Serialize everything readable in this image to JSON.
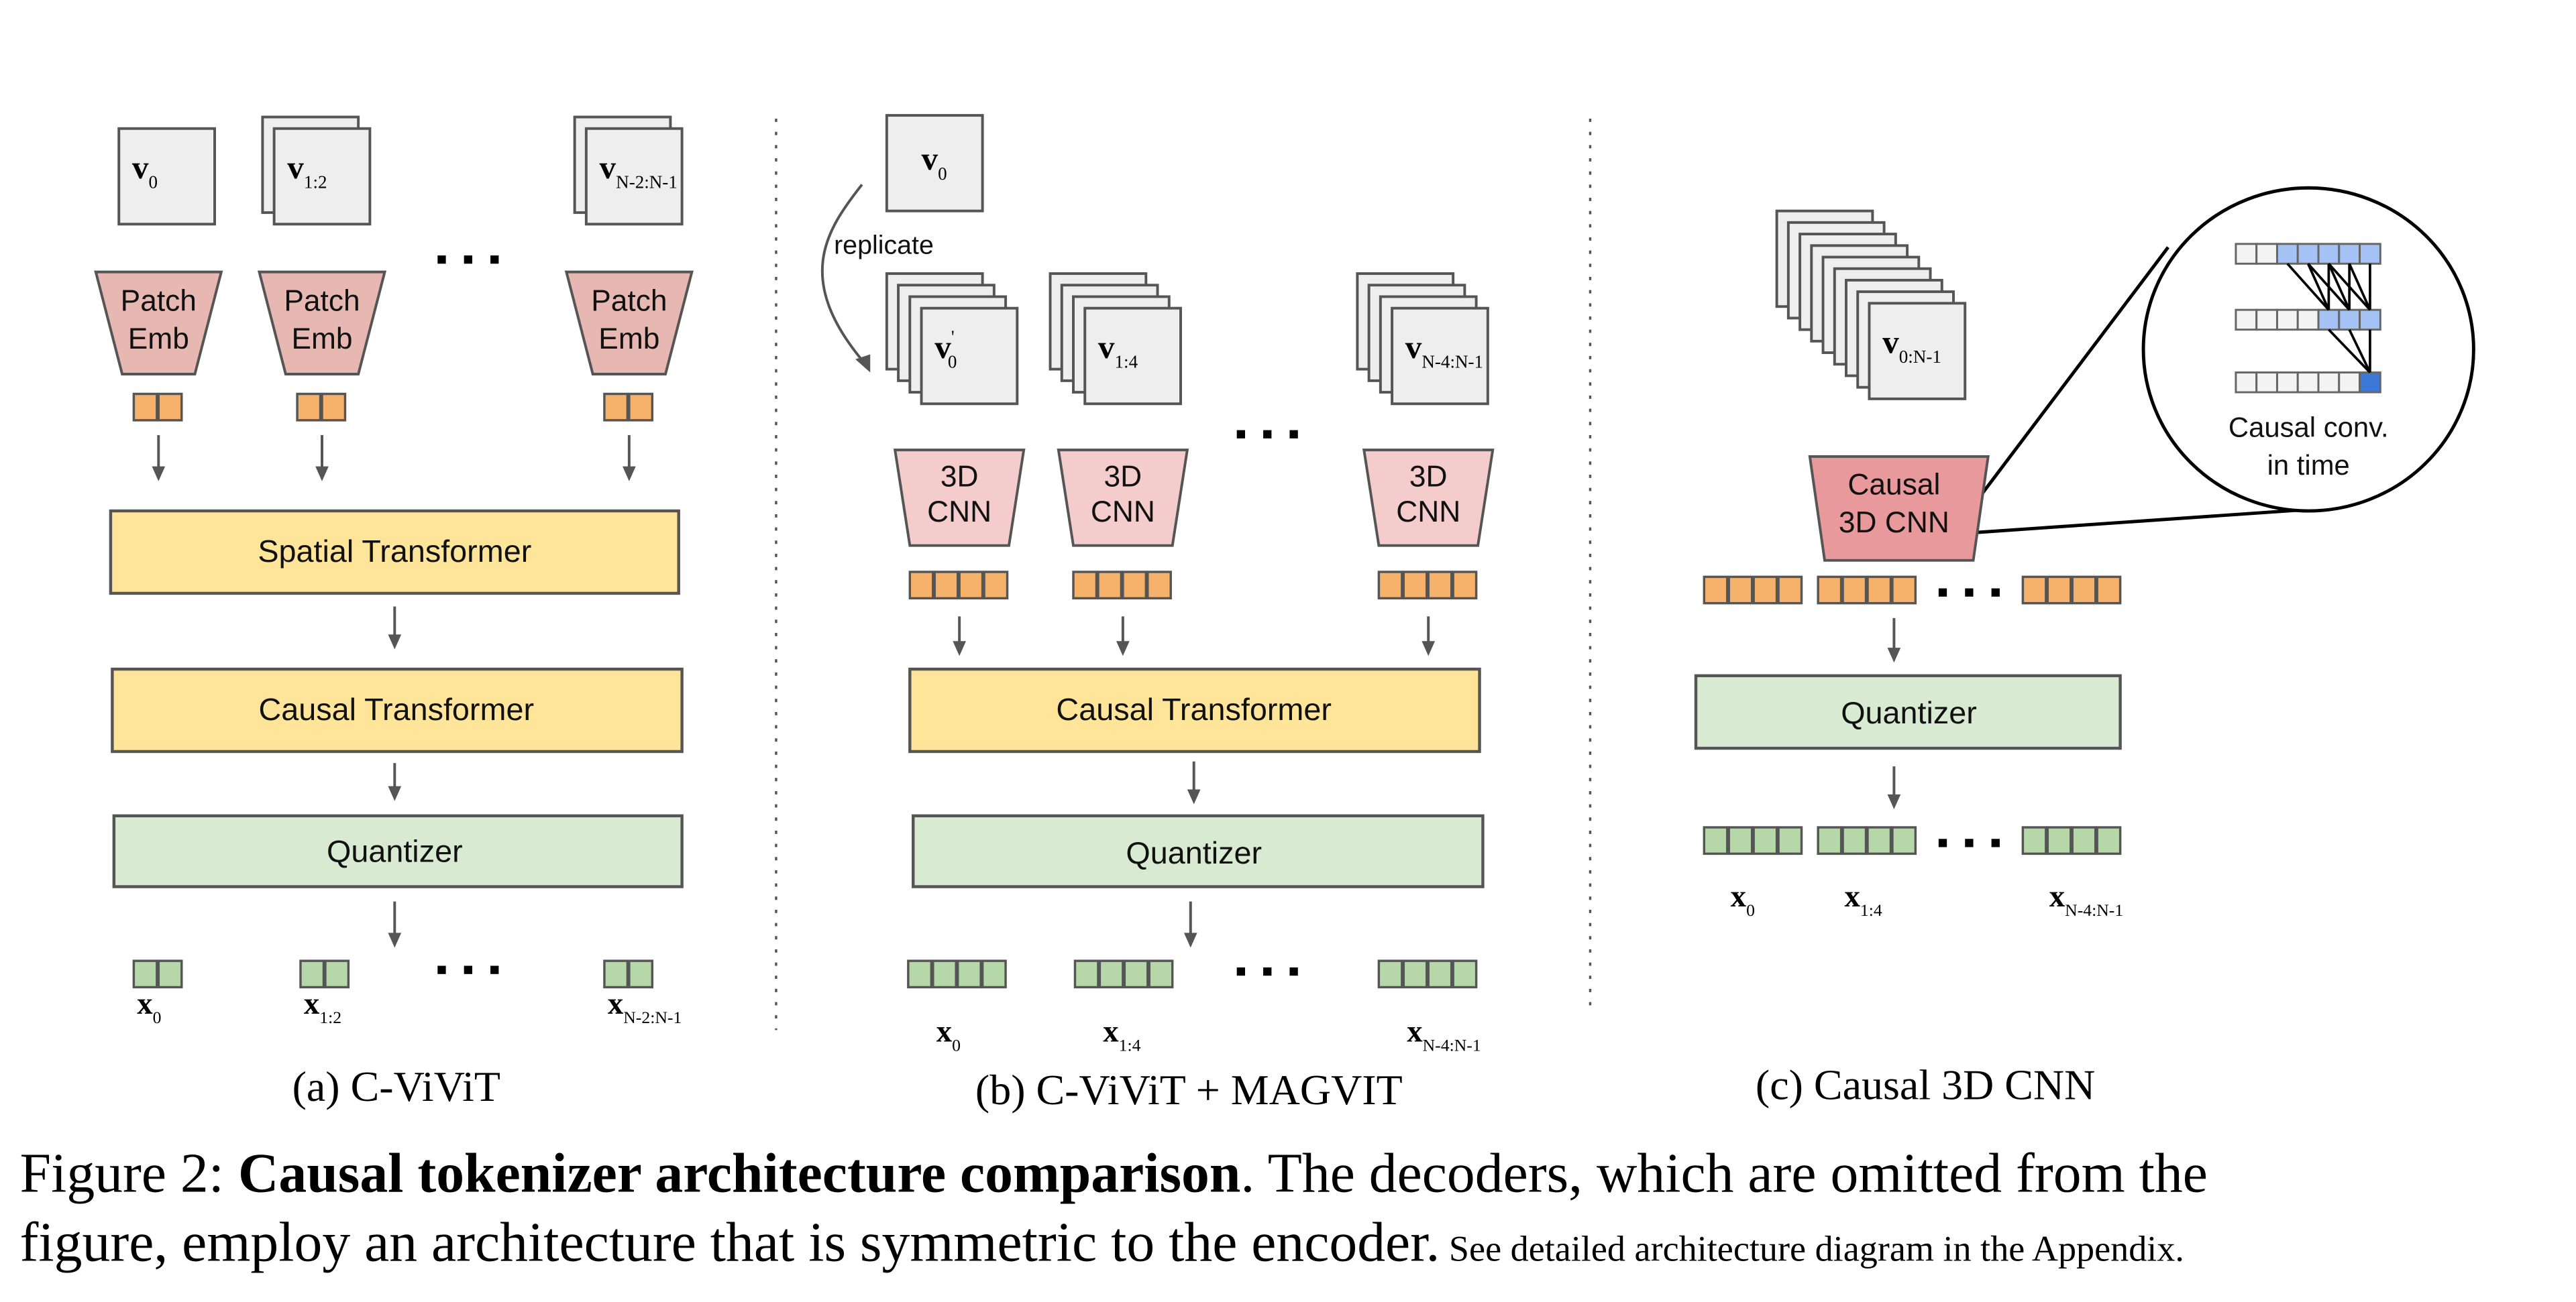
{
  "figure": {
    "panel_a": {
      "frames": [
        {
          "var": "v",
          "sub": "0",
          "stack": 1
        },
        {
          "var": "v",
          "sub": "1:2",
          "stack": 2
        },
        {
          "var": "v",
          "sub": "N-2:N-1",
          "stack": 2
        }
      ],
      "encoder_label_line1": "Patch",
      "encoder_label_line2": "Emb",
      "tokens_per_group": 2,
      "spatial_transformer": "Spatial Transformer",
      "causal_transformer": "Causal Transformer",
      "quantizer": "Quantizer",
      "outputs": [
        {
          "var": "x",
          "sub": "0"
        },
        {
          "var": "x",
          "sub": "1:2"
        },
        {
          "var": "x",
          "sub": "N-2:N-1"
        }
      ],
      "ellipsis": "...",
      "caption": "(a) C-ViViT"
    },
    "panel_b": {
      "source_frame": {
        "var": "v",
        "sub": "0"
      },
      "replicate_label": "replicate",
      "frames": [
        {
          "var": "v",
          "sub": "0",
          "prime": "'",
          "stack": 4
        },
        {
          "var": "v",
          "sub": "1:4",
          "stack": 4
        },
        {
          "var": "v",
          "sub": "N-4:N-1",
          "stack": 4
        }
      ],
      "encoder_label_line1": "3D",
      "encoder_label_line2": "CNN",
      "tokens_per_group": 4,
      "causal_transformer": "Causal Transformer",
      "quantizer": "Quantizer",
      "outputs": [
        {
          "var": "x",
          "sub": "0"
        },
        {
          "var": "x",
          "sub": "1:4"
        },
        {
          "var": "x",
          "sub": "N-4:N-1"
        }
      ],
      "ellipsis": "...",
      "caption": "(b) C-ViViT + MAGVIT"
    },
    "panel_c": {
      "frames": {
        "var": "v",
        "sub": "0:N-1",
        "stack": 9
      },
      "encoder_label_line1": "Causal",
      "encoder_label_line2": "3D CNN",
      "tokens_per_group": 4,
      "quantizer": "Quantizer",
      "outputs": [
        {
          "var": "x",
          "sub": "0"
        },
        {
          "var": "x",
          "sub": "1:4"
        },
        {
          "var": "x",
          "sub": "N-4:N-1"
        }
      ],
      "inset": {
        "label_line1": "Causal conv.",
        "label_line2": "in time",
        "rows": [
          [
            "empty",
            "empty",
            "light",
            "light",
            "light",
            "light",
            "light"
          ],
          [
            "empty",
            "empty",
            "empty",
            "empty",
            "light",
            "light",
            "light"
          ],
          [
            "empty",
            "empty",
            "empty",
            "empty",
            "empty",
            "empty",
            "dark"
          ]
        ]
      },
      "ellipsis": "...",
      "caption": "(c) Causal 3D CNN"
    },
    "caption": {
      "prefix": "Figure 2: ",
      "bold": "Causal tokenizer architecture comparison",
      "rest_line1": ". The decoders, which are omitted from the",
      "rest_line2": "figure, employ an architecture that is symmetric to the encoder.",
      "small": " See detailed architecture diagram in the Appendix."
    }
  },
  "colors": {
    "frame_fill": "#eeeeee",
    "patch_emb": "#e6b8b1",
    "cnn_3d": "#f4cccc",
    "causal_cnn": "#e8999b",
    "transformer": "#ffe599",
    "quantizer": "#d9ead3",
    "token_orange": "#f6b26b",
    "token_green": "#b6d7a8",
    "inset_light_blue": "#a4c2f4",
    "inset_dark_blue": "#3c78d8"
  }
}
